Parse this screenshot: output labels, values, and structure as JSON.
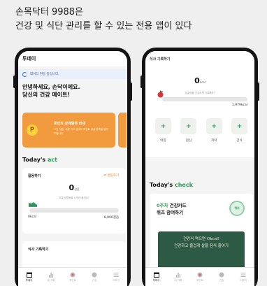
{
  "headline": {
    "line1": "손목닥터 9988은",
    "line2": "건강 및 식단 관리를 할 수 있는 전용 앱이 있다"
  },
  "left_screen": {
    "header_title": "투데이",
    "sync_text": "데이터 연동 중입니다.",
    "greeting_line1": "안녕하세요, 손닥이에요.",
    "greeting_line2": "당신의 건강 메이트!",
    "point_card": {
      "icon_letter": "P",
      "title": "포인트 상세항목 안내",
      "desc": "그간 적립, 사용 이고 참여하 포인트 상세 항목을 알려드립니다"
    },
    "section_title_prefix": "Today's ",
    "section_title_accent": "act",
    "activity": {
      "title": "활동하기",
      "link": "운동하기",
      "value": "0",
      "unit": "걸음",
      "hint": "오늘의 활동을 시작해 볼까요?",
      "min_label": "0kcal",
      "max_label": "8,000걸음",
      "progress": 0
    },
    "meal_card_title": "식사 기록하기",
    "bottom_nav": [
      {
        "label": "투데이",
        "icon": "calendar-icon",
        "active": true
      },
      {
        "label": "내 기록",
        "icon": "bar-chart-icon",
        "active": false
      },
      {
        "label": "포인트",
        "icon": "point-icon",
        "active": false
      },
      {
        "label": "건강",
        "icon": "heart-icon",
        "active": false
      },
      {
        "label": "더보기",
        "icon": "menu-icon",
        "active": false
      }
    ]
  },
  "right_screen": {
    "header_title": "식사 기록하기",
    "kcal_value": "0",
    "kcal_unit": "kcal",
    "kcal_hint": "섭취량을 건강하게 기록해요!",
    "kcal_max": "1,979kcal",
    "kcal_progress": 0,
    "slots": [
      "아침",
      "점심",
      "저녁",
      "간식"
    ],
    "section_title_prefix": "Today's ",
    "section_title_accent": "check",
    "quiz": {
      "title_accent": "0주차",
      "title_rest": " 건강카드",
      "title_line2": "퀴즈 참여하기",
      "badge": "퀴즈",
      "board_line1": "건강식 먹으면 Okcal!",
      "board_line2": "건강하고 즐겁게 살을 음식 줄이기"
    },
    "bottom_nav": [
      {
        "label": "투데이",
        "icon": "calendar-icon",
        "active": true
      },
      {
        "label": "내 기록",
        "icon": "bar-chart-icon",
        "active": false
      },
      {
        "label": "포인트",
        "icon": "point-icon",
        "active": false
      },
      {
        "label": "건강",
        "icon": "heart-icon",
        "active": false
      },
      {
        "label": "더보기",
        "icon": "menu-icon",
        "active": false
      }
    ]
  },
  "colors": {
    "accent_green": "#2e9e5b",
    "card_orange": "#f29a3e",
    "link_orange": "#e07a2d",
    "phone_frame": "#141414"
  }
}
